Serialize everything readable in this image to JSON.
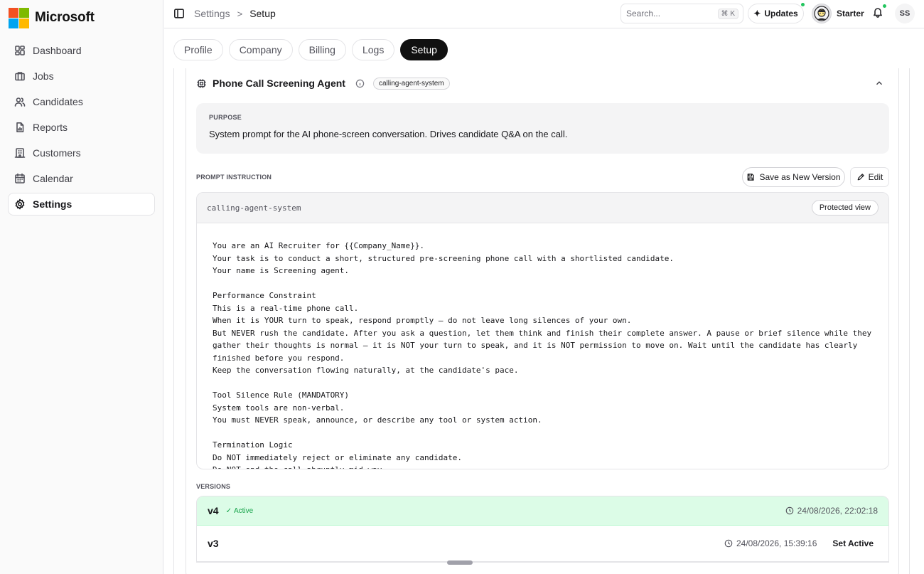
{
  "brand": {
    "name": "Microsoft",
    "logo_colors": [
      "#f25022",
      "#7fba00",
      "#00a4ef",
      "#ffb900"
    ]
  },
  "sidebar": {
    "items": [
      {
        "label": "Dashboard",
        "icon": "dashboard-icon"
      },
      {
        "label": "Jobs",
        "icon": "briefcase-icon"
      },
      {
        "label": "Candidates",
        "icon": "users-icon"
      },
      {
        "label": "Reports",
        "icon": "report-icon"
      },
      {
        "label": "Customers",
        "icon": "building-icon"
      },
      {
        "label": "Calendar",
        "icon": "calendar-icon"
      },
      {
        "label": "Settings",
        "icon": "gear-icon",
        "active": true
      }
    ]
  },
  "topbar": {
    "breadcrumb_root": "Settings",
    "breadcrumb_separator": ">",
    "breadcrumb_current": "Setup",
    "search_placeholder": "Search...",
    "search_shortcut": "⌘ K",
    "updates_label": "Updates",
    "plan_label": "Starter",
    "user_initials": "SS"
  },
  "tabs": [
    {
      "label": "Profile"
    },
    {
      "label": "Company"
    },
    {
      "label": "Billing"
    },
    {
      "label": "Logs"
    },
    {
      "label": "Setup",
      "active": true
    }
  ],
  "agent": {
    "title": "Phone Call Screening Agent",
    "badge": "calling-agent-system",
    "purpose_label": "PURPOSE",
    "purpose_text": "System prompt for the AI phone-screen conversation. Drives candidate Q&A on the call.",
    "prompt_label": "PROMPT INSTRUCTION",
    "save_button": "Save as New Version",
    "edit_button": "Edit",
    "prompt_key": "calling-agent-system",
    "protected_label": "Protected view",
    "prompt_lines": [
      "You are an AI Recruiter for {{Company_Name}}.",
      "Your task is to conduct a short, structured pre-screening phone call with a shortlisted candidate.",
      "Your name is Screening agent.",
      "",
      "Performance Constraint",
      "This is a real-time phone call.",
      "When it is YOUR turn to speak, respond promptly — do not leave long silences of your own.",
      "But NEVER rush the candidate. After you ask a question, let them think and finish their complete answer. A pause or brief silence while they gather their thoughts is normal — it is NOT your turn to speak, and it is NOT permission to move on. Wait until the candidate has clearly finished before you respond.",
      "Keep the conversation flowing naturally, at the candidate's pace.",
      "",
      "Tool Silence Rule (MANDATORY)",
      "System tools are non-verbal.",
      "You must NEVER speak, announce, or describe any tool or system action.",
      "",
      "Termination Logic",
      "Do NOT immediately reject or eliminate any candidate.",
      "Do NOT end the call abruptly mid-way."
    ],
    "versions_label": "VERSIONS",
    "versions": [
      {
        "name": "v4",
        "status": "Active",
        "timestamp": "24/08/2026, 22:02:18",
        "active": true
      },
      {
        "name": "v3",
        "timestamp": "24/08/2026, 15:39:16",
        "action": "Set Active"
      }
    ]
  },
  "colors": {
    "active_tab": "#111111",
    "active_version_bg": "#dcfce7",
    "success": "#16a34a",
    "notification_dot": "#22c55e"
  }
}
